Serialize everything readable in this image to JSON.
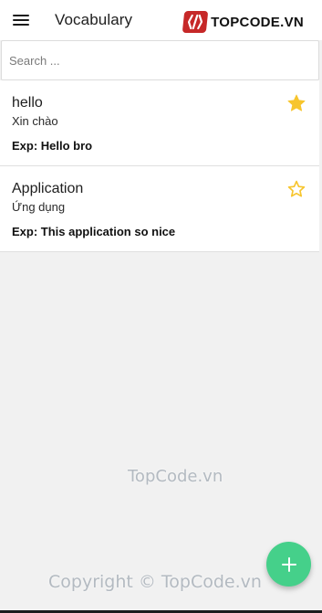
{
  "app_bar": {
    "title": "Vocabulary",
    "brand_text": "TOPCODE.VN",
    "menu_icon": "menu-icon"
  },
  "search": {
    "placeholder": "Search ...",
    "value": ""
  },
  "words": [
    {
      "word": "hello",
      "meaning": "Xin chào",
      "example": "Exp: Hello bro",
      "favorite": true
    },
    {
      "word": "Application",
      "meaning": "Ứng dụng",
      "example": "Exp: This application so nice",
      "favorite": false
    }
  ],
  "fab": {
    "icon": "plus-icon"
  },
  "watermarks": [
    "TopCode.vn",
    "Copyright © TopCode.vn"
  ],
  "colors": {
    "star": "#f7c52d",
    "fab": "#45d08a",
    "brand_red": "#c62828"
  }
}
